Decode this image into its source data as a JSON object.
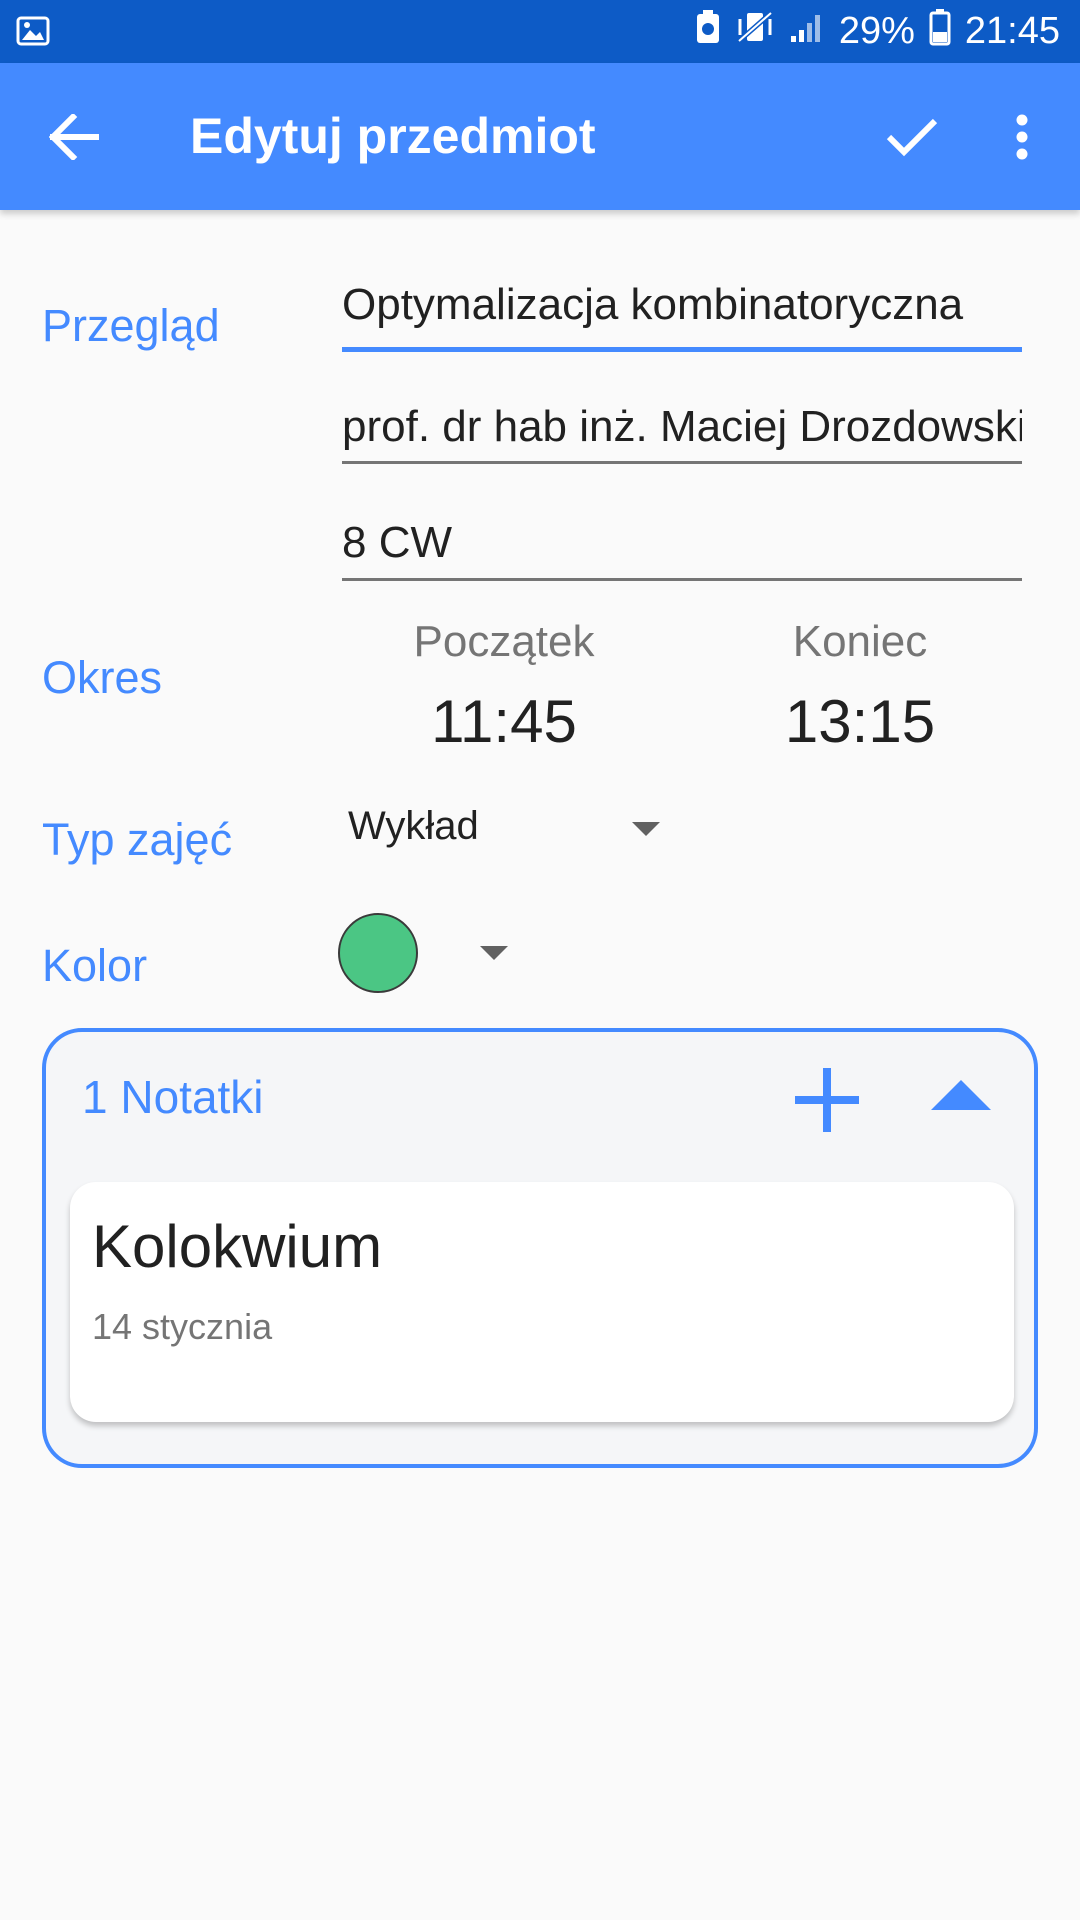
{
  "status_bar": {
    "battery": "29%",
    "time": "21:45",
    "icons": [
      "gallery-icon",
      "battery-saver-icon",
      "vibrate-icon",
      "signal-icon",
      "battery-icon"
    ]
  },
  "app_bar": {
    "title": "Edytuj przedmiot",
    "back_icon": "arrow-back-icon",
    "confirm_icon": "check-icon",
    "menu_icon": "more-vert-icon"
  },
  "form": {
    "overview_label": "Przegląd",
    "subject_name": "Optymalizacja kombinatoryczna",
    "teacher": "prof. dr hab inż. Maciej Drozdowski",
    "room": "8 CW",
    "period_label": "Okres",
    "start_caption": "Początek",
    "start_time": "11:45",
    "end_caption": "Koniec",
    "end_time": "13:15",
    "type_label": "Typ zajęć",
    "type_value": "Wykład",
    "color_label": "Kolor",
    "color_value": "#4bc684"
  },
  "notes": {
    "header": "1 Notatki",
    "add_icon": "plus-icon",
    "collapse_icon": "chevron-up-icon",
    "items": [
      {
        "title": "Kolokwium",
        "date": "14 stycznia"
      }
    ]
  },
  "colors": {
    "primary": "#448aff",
    "status_bar": "#0d5bc6"
  }
}
